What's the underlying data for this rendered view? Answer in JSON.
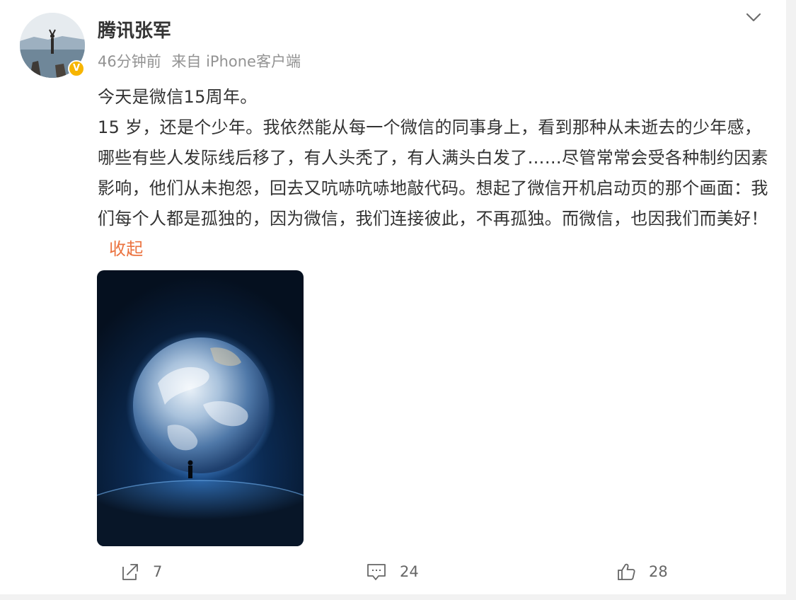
{
  "post": {
    "author": {
      "name": "腾讯张军",
      "avatar_icon": "profile-photo",
      "verified_icon": "verified-v-badge",
      "verified_color": "#f7b500"
    },
    "meta": {
      "time": "46分钟前",
      "source": "来自 iPhone客户端"
    },
    "menu_icon": "chevron-down-icon",
    "content": {
      "line1": "今天是微信15周年。",
      "body": "15 岁，还是个少年。我依然能从每一个微信的同事身上，看到那种从未逝去的少年感，哪些有些人发际线后移了，有人头秃了，有人满头白发了……尽管常常会受各种制约因素影响，他们从未抱怨，回去又吭哧吭哧地敲代码。想起了微信开机启动页的那个画面：我们每个人都是孤独的，因为微信，我们连接彼此，不再孤独。而微信，也因我们而美好！",
      "collapse_label": "收起",
      "link_color": "#eb7340"
    },
    "image": {
      "description_icon": "earth-from-space-image"
    },
    "actions": {
      "share_count": "7",
      "comment_count": "24",
      "like_count": "28",
      "share_icon": "share-icon",
      "comment_icon": "comment-icon",
      "like_icon": "thumbs-up-icon"
    }
  }
}
